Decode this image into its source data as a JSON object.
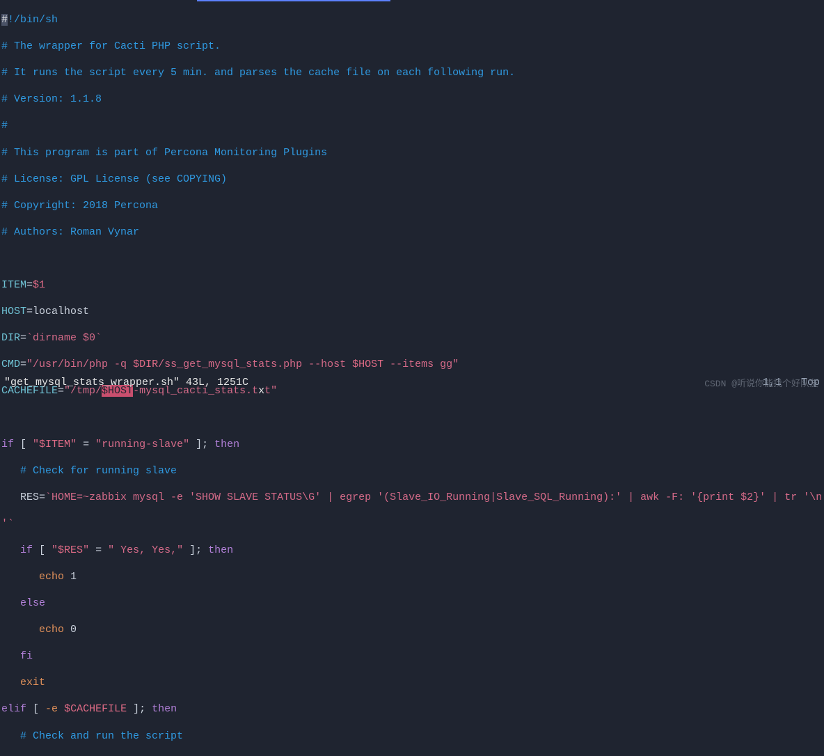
{
  "code": {
    "l01_a": "#",
    "l01_b": "!/bin/sh",
    "l02": "# The wrapper for Cacti PHP script.",
    "l03": "# It runs the script every 5 min. and parses the cache file on each following run.",
    "l04": "# Version: 1.1.8",
    "l05": "#",
    "l06": "# This program is part of Percona Monitoring Plugins",
    "l07": "# License: GPL License (see COPYING)",
    "l08": "# Copyright: 2018 Percona",
    "l09": "# Authors: Roman Vynar",
    "l11_a": "ITEM",
    "l11_b": "=",
    "l11_c": "$1",
    "l12_a": "HOST",
    "l12_b": "=localhost",
    "l13_a": "DIR",
    "l13_b": "=",
    "l13_c": "`dirname $0`",
    "l14_a": "CMD",
    "l14_b": "=",
    "l14_c": "\"/usr/bin/php -q ",
    "l14_d": "$DIR",
    "l14_e": "/ss_get_mysql_stats.php --host ",
    "l14_f": "$HOST",
    "l14_g": " --items gg\"",
    "l15_a": "CACHEFILE",
    "l15_b": "=",
    "l15_c": "\"/tmp/",
    "l15_d": "$HOST",
    "l15_e": "-mysql_cacti_stats.t",
    "l15_caret": "x",
    "l15_f": "t\"",
    "l17_a": "if",
    "l17_b": " [ ",
    "l17_c": "\"",
    "l17_d": "$ITEM",
    "l17_e": "\"",
    "l17_f": " = ",
    "l17_g": "\"running-slave\"",
    "l17_h": " ]; ",
    "l17_i": "then",
    "l18": "   # Check for running slave",
    "l19_a": "   RES=",
    "l19_b": "`HOME=~zabbix mysql -e 'SHOW SLAVE STATUS\\G' | egrep '(Slave_IO_Running|Slave_SQL_Running):' | awk -F: '{print $2}' | tr '\\n' ',",
    "l19_c": "'`",
    "l20_a": "   if",
    "l20_b": " [ ",
    "l20_c": "\"",
    "l20_d": "$RES",
    "l20_e": "\"",
    "l20_f": " = ",
    "l20_g": "\" Yes, Yes,\"",
    "l20_h": " ]; ",
    "l20_i": "then",
    "l21_a": "      echo",
    "l21_b": " 1",
    "l22": "   else",
    "l23_a": "      echo",
    "l23_b": " 0",
    "l24": "   fi",
    "l25": "   exit",
    "l26_a": "elif",
    "l26_b": " [ ",
    "l26_c": "-e",
    "l26_d": " ",
    "l26_e": "$CACHEFILE",
    "l26_f": " ]; ",
    "l26_g": "then",
    "l27": "   # Check and run the script"
  },
  "status": {
    "left": "\"get_mysql_stats_wrapper.sh\" 43L, 1251C",
    "pos": "1,1",
    "scroll": "Top"
  },
  "watermark": "CSDN @听说你能找个好队友"
}
